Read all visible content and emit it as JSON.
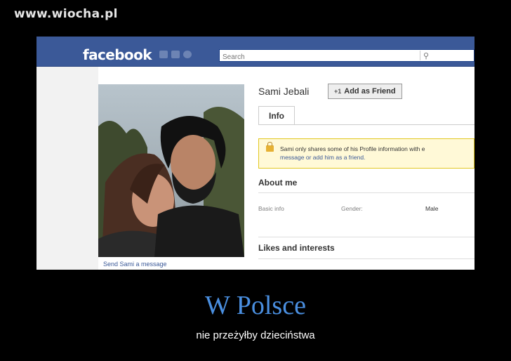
{
  "watermark": "www.wiocha.pl",
  "header": {
    "logo": "facebook",
    "search_placeholder": "Search",
    "bar_color": "#3b5998"
  },
  "profile": {
    "name": "Sami Jebali",
    "add_friend_label": "Add as Friend",
    "tab_info": "Info",
    "notice_line1": "Sami only shares some of his Profile information with e",
    "notice_line2": "message or add him as a friend.",
    "send_message": "Send Sami a message",
    "about_heading": "About me",
    "basic_info_label": "Basic info",
    "gender_label": "Gender:",
    "gender_value": "Male",
    "likes_heading": "Likes and interests"
  },
  "caption": {
    "title": "W Polsce",
    "subtitle": "nie przeżyłby dzieciństwa",
    "title_color": "#4a8fe0"
  }
}
